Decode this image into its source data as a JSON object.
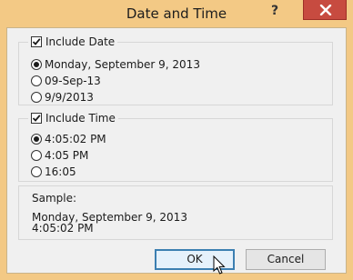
{
  "title": "Date and Time",
  "help_glyph": "?",
  "date_group": {
    "label": "Include Date",
    "checked": true,
    "options": [
      {
        "label": "Monday, September 9, 2013",
        "checked": true
      },
      {
        "label": "09-Sep-13",
        "checked": false
      },
      {
        "label": "9/9/2013",
        "checked": false
      }
    ]
  },
  "time_group": {
    "label": "Include Time",
    "checked": true,
    "options": [
      {
        "label": "4:05:02 PM",
        "checked": true
      },
      {
        "label": "4:05 PM",
        "checked": false
      },
      {
        "label": "16:05",
        "checked": false
      }
    ]
  },
  "sample": {
    "label": "Sample:",
    "line1": "Monday, September 9, 2013",
    "line2": "4:05:02 PM"
  },
  "buttons": {
    "ok": "OK",
    "cancel": "Cancel"
  },
  "colors": {
    "title_bar": "#f3c985",
    "close_button": "#c74b40",
    "dialog_bg": "#f0f0f0"
  }
}
